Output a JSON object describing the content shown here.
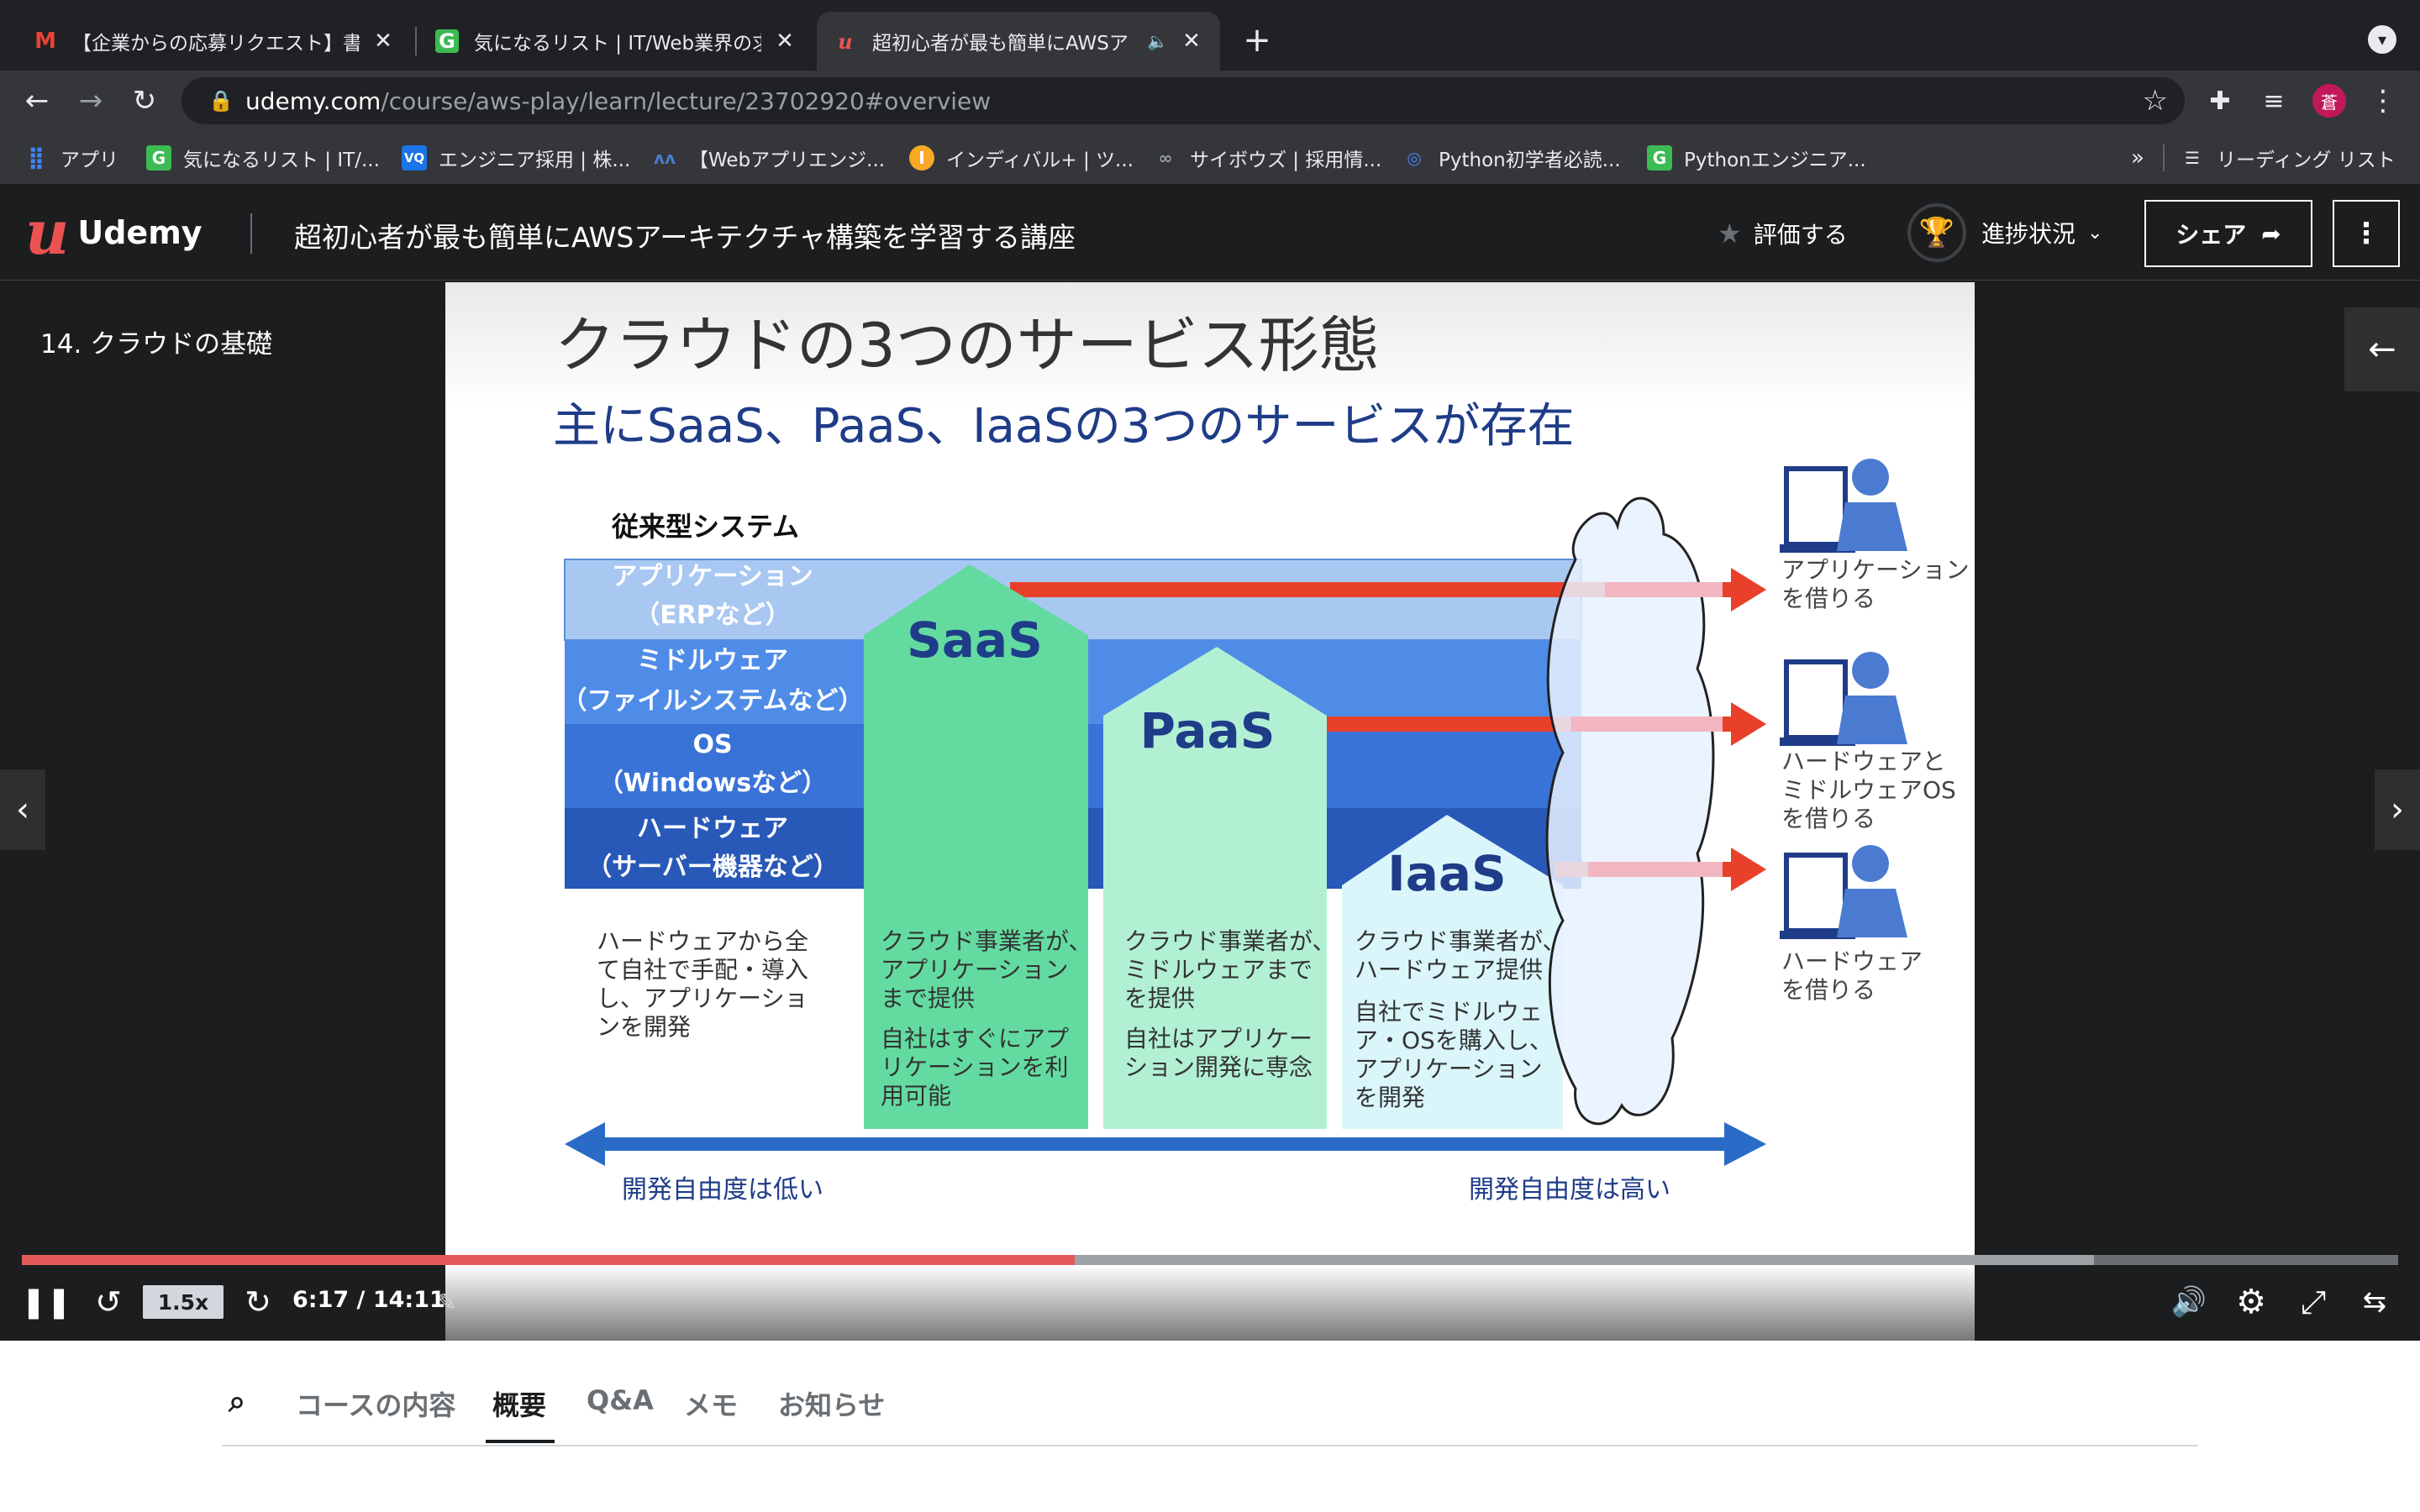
{
  "browser": {
    "tabs": [
      {
        "title": "【企業からの応募リクエスト】書類",
        "favicon": "gmail"
      },
      {
        "title": "気になるリスト | IT/Web業界の求",
        "favicon": "green-g"
      },
      {
        "title": "超初心者が最も簡単にAWSア",
        "favicon": "udemy"
      }
    ],
    "new_tab_symbol": "+",
    "url_domain": "udemy.com",
    "url_path": "/course/aws-play/learn/lecture/23702920#overview",
    "profile_initial": "蒼",
    "bookmarks": [
      {
        "label": "アプリ",
        "icon": "apps-grid"
      },
      {
        "label": "気になるリスト | IT/...",
        "icon": "green-g"
      },
      {
        "label": "エンジニア採用 | 株...",
        "icon": "vq"
      },
      {
        "label": "【Webアプリエンジ...",
        "icon": "mountain"
      },
      {
        "label": "インディバル+ | ツ...",
        "icon": "yellow-circle"
      },
      {
        "label": "サイボウズ | 採用情...",
        "icon": "cybozu"
      },
      {
        "label": "Python初学者必読...",
        "icon": "python-globe"
      },
      {
        "label": "Pythonエンジニア...",
        "icon": "green-g"
      }
    ],
    "bookmarks_overflow": "»",
    "reading_list": "リーディング リスト"
  },
  "udemy": {
    "logo_word": "Udemy",
    "course_title": "超初心者が最も簡単にAWSアーキテクチャ構築を学習する講座",
    "rate_label": "評価する",
    "progress_label": "進捗状況",
    "share_label": "シェア",
    "lecture_title": "14. クラウドの基礎"
  },
  "slide": {
    "title": "クラウドの3つのサービス形態",
    "subtitle": "主にSaaS、PaaS、IaaSの3つのサービスが存在",
    "legacy_label": "従来型システム",
    "layers": [
      {
        "line1": "アプリケーション",
        "line2": "（ERPなど）"
      },
      {
        "line1": "ミドルウェア",
        "line2": "（ファイルシステムなど）"
      },
      {
        "line1": "OS",
        "line2": "（Windowsなど）"
      },
      {
        "line1": "ハードウェア",
        "line2": "（サーバー機器など）"
      }
    ],
    "saas": "SaaS",
    "paas": "PaaS",
    "iaas": "IaaS",
    "legacy_desc": [
      "ハードウェアから全",
      "て自社で手配・導入",
      "し、アプリケーショ",
      "ンを開発"
    ],
    "saas_desc1": [
      "クラウド事業者が、",
      "アプリケーション",
      "まで提供"
    ],
    "saas_desc2": [
      "自社はすぐにアプ",
      "リケーションを利",
      "用可能"
    ],
    "paas_desc1": [
      "クラウド事業者が、",
      "ミドルウェアまで",
      "を提供"
    ],
    "paas_desc2": [
      "自社はアプリケー",
      "ション開発に専念"
    ],
    "iaas_desc1": [
      "クラウド事業者が、",
      "ハードウェア提供"
    ],
    "iaas_desc2": [
      "自社でミドルウェ",
      "ア・OSを購入し、",
      "アプリケーション",
      "を開発"
    ],
    "user1": [
      "アプリケーション",
      "を借りる"
    ],
    "user2": [
      "ハードウェアと",
      "ミドルウェアOS",
      "を借りる"
    ],
    "user3": [
      "ハードウェア",
      "を借りる"
    ],
    "freedom_low": "開発自由度は低い",
    "freedom_high": "開発自由度は高い"
  },
  "player": {
    "speed": "1.5x",
    "time": "6:17 / 14:11",
    "played_fraction": 0.443,
    "buffered_fraction": 0.872
  },
  "bottom_tabs": [
    "コースの内容",
    "概要",
    "Q&A",
    "メモ",
    "お知らせ"
  ],
  "selected_bottom_tab": "概要"
}
